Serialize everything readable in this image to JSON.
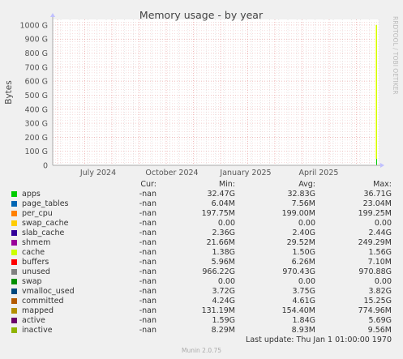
{
  "chart_data": {
    "type": "area",
    "title": "Memory usage - by year",
    "ylabel": "Bytes",
    "side_label": "RRDTOOL / TOBI OETIKER",
    "y_ticks": [
      {
        "label": "0",
        "value": 0
      },
      {
        "label": "100 G",
        "value": 100
      },
      {
        "label": "200 G",
        "value": 200
      },
      {
        "label": "300 G",
        "value": 300
      },
      {
        "label": "400 G",
        "value": 400
      },
      {
        "label": "500 G",
        "value": 500
      },
      {
        "label": "600 G",
        "value": 600
      },
      {
        "label": "700 G",
        "value": 700
      },
      {
        "label": "800 G",
        "value": 800
      },
      {
        "label": "900 G",
        "value": 900
      },
      {
        "label": "1000 G",
        "value": 1000
      }
    ],
    "ylim": [
      0,
      1040
    ],
    "x_ticks": [
      "July 2024",
      "October 2024",
      "January 2025",
      "April 2025"
    ],
    "grid": true,
    "columns": [
      "Cur:",
      "Min:",
      "Avg:",
      "Max:"
    ],
    "series": [
      {
        "name": "apps",
        "color": "#00cc00",
        "cur": "-nan",
        "min": "32.47G",
        "avg": "32.83G",
        "max": "36.71G"
      },
      {
        "name": "page_tables",
        "color": "#0066b3",
        "cur": "-nan",
        "min": "6.04M",
        "avg": "7.56M",
        "max": "23.04M"
      },
      {
        "name": "per_cpu",
        "color": "#ff8000",
        "cur": "-nan",
        "min": "197.75M",
        "avg": "199.00M",
        "max": "199.25M"
      },
      {
        "name": "swap_cache",
        "color": "#ffcc00",
        "cur": "-nan",
        "min": "0.00",
        "avg": "0.00",
        "max": "0.00"
      },
      {
        "name": "slab_cache",
        "color": "#330099",
        "cur": "-nan",
        "min": "2.36G",
        "avg": "2.40G",
        "max": "2.44G"
      },
      {
        "name": "shmem",
        "color": "#990099",
        "cur": "-nan",
        "min": "21.66M",
        "avg": "29.52M",
        "max": "249.29M"
      },
      {
        "name": "cache",
        "color": "#ccff00",
        "cur": "-nan",
        "min": "1.38G",
        "avg": "1.50G",
        "max": "1.56G"
      },
      {
        "name": "buffers",
        "color": "#ff0000",
        "cur": "-nan",
        "min": "5.96M",
        "avg": "6.26M",
        "max": "7.10M"
      },
      {
        "name": "unused",
        "color": "#808080",
        "cur": "-nan",
        "min": "966.22G",
        "avg": "970.43G",
        "max": "970.88G"
      },
      {
        "name": "swap",
        "color": "#008f00",
        "cur": "-nan",
        "min": "0.00",
        "avg": "0.00",
        "max": "0.00"
      },
      {
        "name": "vmalloc_used",
        "color": "#00487d",
        "cur": "-nan",
        "min": "3.72G",
        "avg": "3.75G",
        "max": "3.82G"
      },
      {
        "name": "committed",
        "color": "#b35a00",
        "cur": "-nan",
        "min": "4.24G",
        "avg": "4.61G",
        "max": "15.25G"
      },
      {
        "name": "mapped",
        "color": "#b38f00",
        "cur": "-nan",
        "min": "131.19M",
        "avg": "154.40M",
        "max": "774.96M"
      },
      {
        "name": "active",
        "color": "#6b006b",
        "cur": "-nan",
        "min": "1.59G",
        "avg": "1.84G",
        "max": "5.69G"
      },
      {
        "name": "inactive",
        "color": "#8fb300",
        "cur": "-nan",
        "min": "8.29M",
        "avg": "8.93M",
        "max": "9.56M"
      }
    ],
    "last_update": "Last update: Thu Jan  1 01:00:00 1970",
    "footer": "Munin 2.0.75"
  }
}
